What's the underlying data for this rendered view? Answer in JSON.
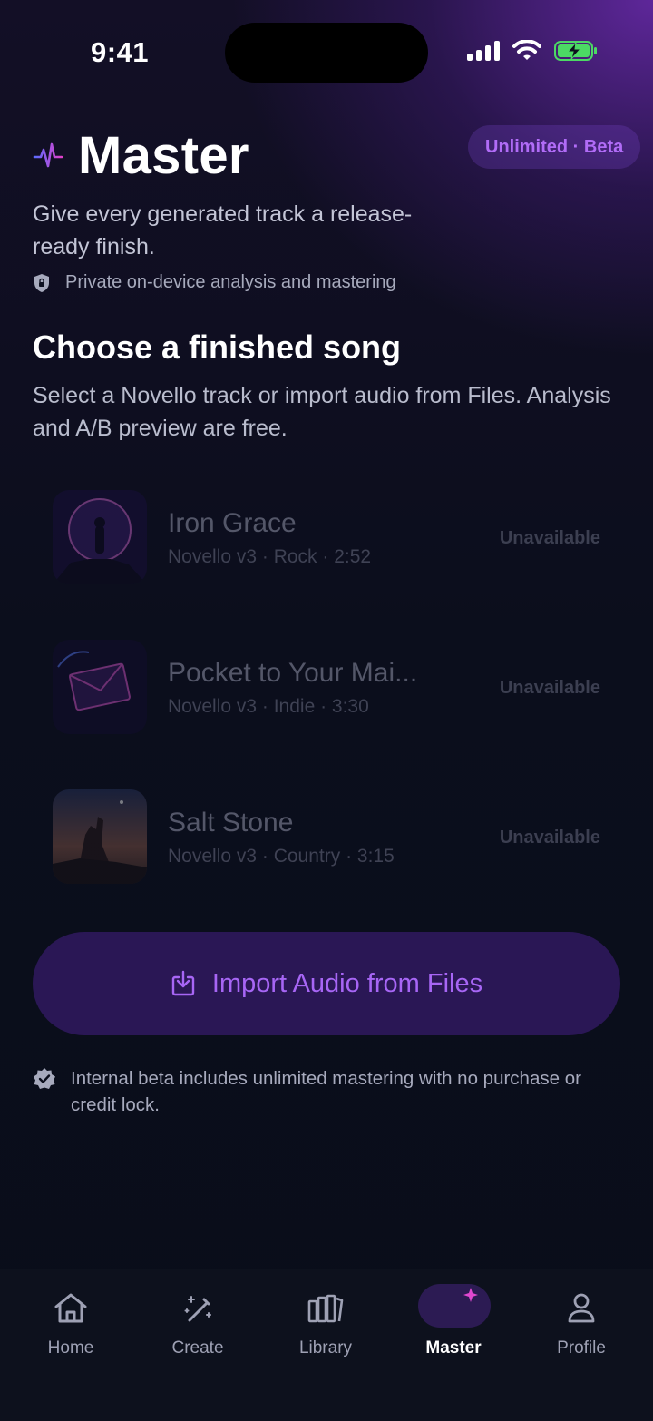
{
  "status_bar": {
    "time": "9:41"
  },
  "header": {
    "title": "Master",
    "icon": "pulse-icon",
    "badge": "Unlimited · Beta",
    "subtitle": "Give every generated track a release-ready finish.",
    "privacy_text": "Private on-device analysis and mastering"
  },
  "section": {
    "title": "Choose a finished song",
    "description": "Select a Novello track or import audio from Files. Analysis and A/B preview are free."
  },
  "tracks": [
    {
      "name": "Iron Grace",
      "meta": "Novello v3 · Rock · 2:52",
      "status": "Unavailable"
    },
    {
      "name": "Pocket to Your Mai...",
      "meta": "Novello v3 · Indie · 3:30",
      "status": "Unavailable"
    },
    {
      "name": "Salt Stone",
      "meta": "Novello v3 · Country · 3:15",
      "status": "Unavailable"
    }
  ],
  "import_button": {
    "label": "Import Audio from Files",
    "icon": "import-icon"
  },
  "beta_note": {
    "text": "Internal beta includes unlimited mastering with no purchase or credit lock."
  },
  "tab_bar": {
    "tabs": [
      {
        "label": "Home",
        "icon": "home-icon"
      },
      {
        "label": "Create",
        "icon": "magic-wand-icon"
      },
      {
        "label": "Library",
        "icon": "library-icon"
      },
      {
        "label": "Master",
        "icon": "waveform-sparkle-icon"
      },
      {
        "label": "Profile",
        "icon": "person-icon"
      }
    ],
    "active": "Master"
  },
  "colors": {
    "accent": "#a766f5",
    "button_bg": "#2a1755",
    "battery_green": "#4cd964"
  }
}
